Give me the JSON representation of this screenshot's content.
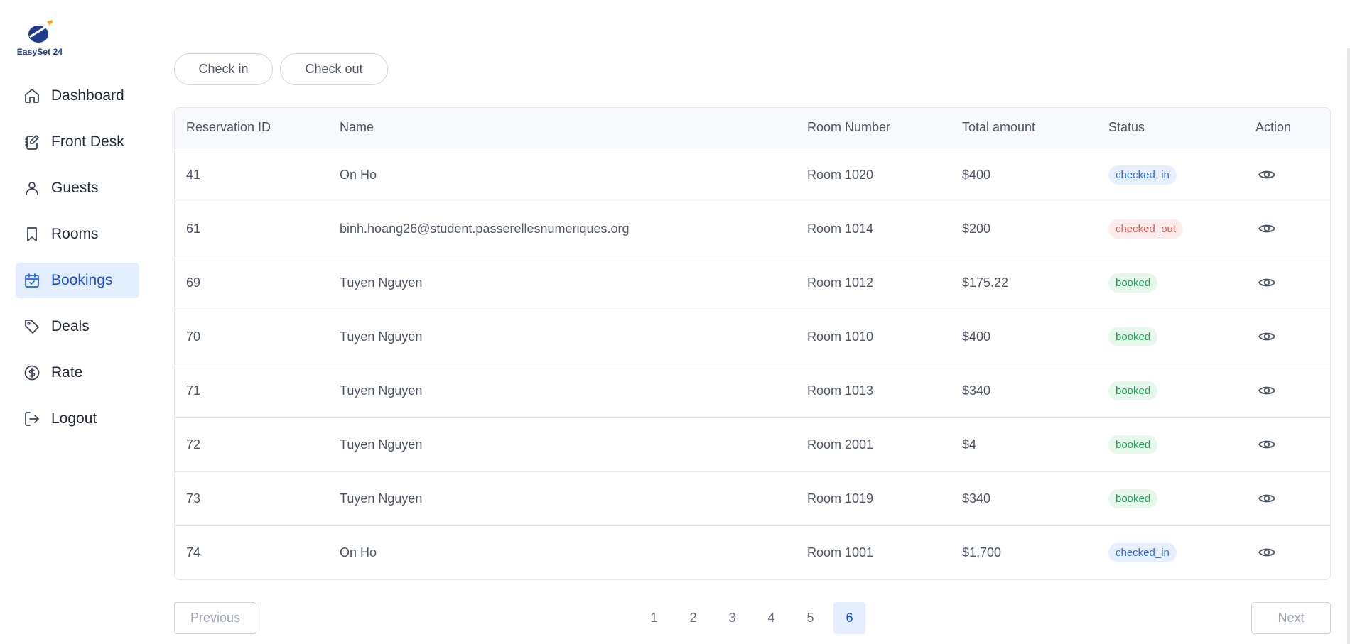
{
  "app": {
    "logo_text": "EasySet 24"
  },
  "sidebar": {
    "items": [
      {
        "label": "Dashboard",
        "icon": "home-icon",
        "active": false
      },
      {
        "label": "Front Desk",
        "icon": "notebook-pen-icon",
        "active": false
      },
      {
        "label": "Guests",
        "icon": "user-icon",
        "active": false
      },
      {
        "label": "Rooms",
        "icon": "bookmark-icon",
        "active": false
      },
      {
        "label": "Bookings",
        "icon": "calendar-check-icon",
        "active": true
      },
      {
        "label": "Deals",
        "icon": "tag-icon",
        "active": false
      },
      {
        "label": "Rate",
        "icon": "dollar-circle-icon",
        "active": false
      },
      {
        "label": "Logout",
        "icon": "logout-icon",
        "active": false
      }
    ]
  },
  "toolbar": {
    "check_in_label": "Check in",
    "check_out_label": "Check out"
  },
  "table": {
    "columns": [
      "Reservation ID",
      "Name",
      "Room Number",
      "Total amount",
      "Status",
      "Action"
    ],
    "rows": [
      {
        "id": "41",
        "name": "On Ho",
        "room": "Room 1020",
        "amount": "$400",
        "status": "checked_in"
      },
      {
        "id": "61",
        "name": "binh.hoang26@student.passerellesnumeriques.org",
        "room": "Room 1014",
        "amount": "$200",
        "status": "checked_out"
      },
      {
        "id": "69",
        "name": "Tuyen Nguyen",
        "room": "Room 1012",
        "amount": "$175.22",
        "status": "booked"
      },
      {
        "id": "70",
        "name": "Tuyen Nguyen",
        "room": "Room 1010",
        "amount": "$400",
        "status": "booked"
      },
      {
        "id": "71",
        "name": "Tuyen Nguyen",
        "room": "Room 1013",
        "amount": "$340",
        "status": "booked"
      },
      {
        "id": "72",
        "name": "Tuyen Nguyen",
        "room": "Room 2001",
        "amount": "$4",
        "status": "booked"
      },
      {
        "id": "73",
        "name": "Tuyen Nguyen",
        "room": "Room 1019",
        "amount": "$340",
        "status": "booked"
      },
      {
        "id": "74",
        "name": "On Ho",
        "room": "Room 1001",
        "amount": "$1,700",
        "status": "checked_in"
      }
    ]
  },
  "pagination": {
    "previous_label": "Previous",
    "next_label": "Next",
    "pages": [
      "1",
      "2",
      "3",
      "4",
      "5",
      "6"
    ],
    "current_page": "6"
  },
  "colors": {
    "accent": "#1d4ed8",
    "active_bg": "#e3efff",
    "booked": "#22a355",
    "checked_in": "#2f6fe0",
    "checked_out": "#e05a5a"
  }
}
